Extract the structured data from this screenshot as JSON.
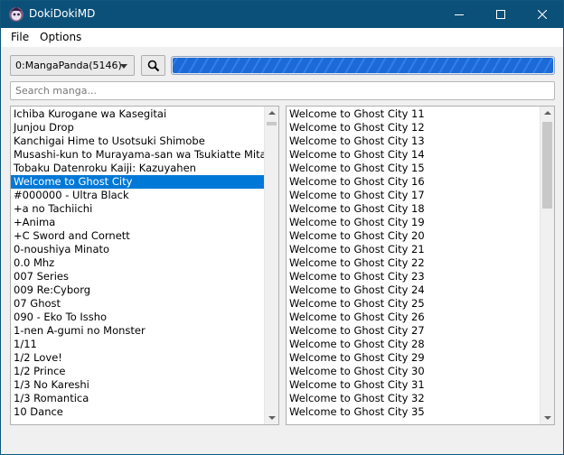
{
  "window": {
    "title": "DokiDokiMD",
    "icon": "app-logo-icon"
  },
  "title_controls": {
    "minimize": "minimize-icon",
    "maximize": "maximize-icon",
    "close": "close-icon"
  },
  "menu": {
    "items": [
      "File",
      "Options"
    ]
  },
  "toolbar": {
    "source_selected": "0:MangaPanda(5146)",
    "search_button_icon": "search-icon",
    "progress": 1.0
  },
  "search": {
    "placeholder": "Search manga...",
    "value": ""
  },
  "manga_list": {
    "selected_index": 5,
    "items": [
      "Ichiba Kurogane wa Kasegitai",
      "Junjou Drop",
      "Kanchigai Hime to Usotsuki Shimobe",
      "Musashi-kun to Murayama-san wa Tsukiatte Mita.",
      "Tobaku Datenroku Kaiji: Kazuyahen",
      "Welcome to Ghost City",
      "#000000 - Ultra Black",
      "+a no Tachiichi",
      "+Anima",
      "+C Sword and Cornett",
      "0-noushiya Minato",
      "0.0 Mhz",
      "007 Series",
      "009 Re:Cyborg",
      "07 Ghost",
      "090 - Eko To Issho",
      "1-nen A-gumi no Monster",
      "1/11",
      "1/2 Love!",
      "1/2 Prince",
      "1/3 No Kareshi",
      "1/3 Romantica",
      "10 Dance"
    ]
  },
  "chapter_list": {
    "items": [
      "Welcome to Ghost City 11",
      "Welcome to Ghost City 12",
      "Welcome to Ghost City 13",
      "Welcome to Ghost City 14",
      "Welcome to Ghost City 15",
      "Welcome to Ghost City 16",
      "Welcome to Ghost City 17",
      "Welcome to Ghost City 18",
      "Welcome to Ghost City 19",
      "Welcome to Ghost City 20",
      "Welcome to Ghost City 21",
      "Welcome to Ghost City 22",
      "Welcome to Ghost City 23",
      "Welcome to Ghost City 24",
      "Welcome to Ghost City 25",
      "Welcome to Ghost City 26",
      "Welcome to Ghost City 27",
      "Welcome to Ghost City 28",
      "Welcome to Ghost City 29",
      "Welcome to Ghost City 30",
      "Welcome to Ghost City 31",
      "Welcome to Ghost City 32",
      "Welcome to Ghost City 35"
    ]
  },
  "colors": {
    "titlebar": "#0b5078",
    "selection": "#0078d7",
    "progress": "#1d6ad6"
  }
}
